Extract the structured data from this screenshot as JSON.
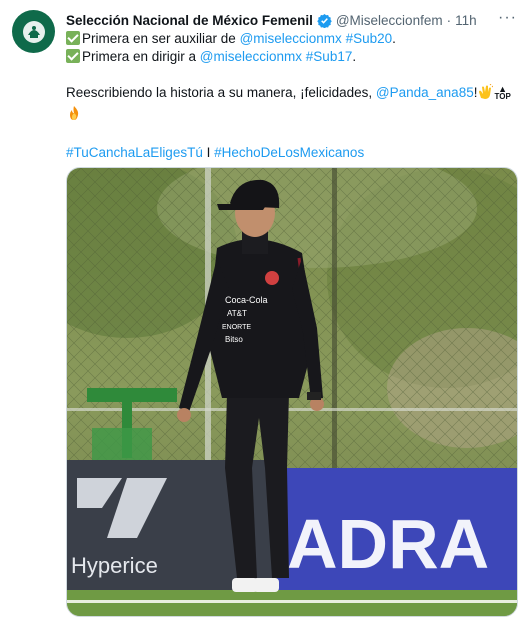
{
  "tweet": {
    "author": {
      "display_name": "Selección Nacional de México Femenil",
      "handle": "@Miseleccionfem",
      "verified": true
    },
    "separator": "·",
    "time": "11h",
    "more_label": "···",
    "text": {
      "line1_prefix": "Primera en ser auxiliar de ",
      "line1_mention": "@miseleccionmx",
      "line1_space": " ",
      "line1_hashtag": "#Sub20",
      "line1_suffix": ".",
      "line2_prefix": "Primera en dirigir a ",
      "line2_mention": "@miseleccionmx",
      "line2_space": " ",
      "line2_hashtag": "#Sub17",
      "line2_suffix": ".",
      "line3_prefix": "Reescribiendo la historia a su manera, ¡felicidades, ",
      "line3_mention": "@Panda_ana85",
      "line3_suffix": "!",
      "top_badge": "TOP",
      "hashtag_a": "#TuCanchaLaEligesTú",
      "hashtag_sep": " I ",
      "hashtag_b": "#HechoDeLosMexicanos"
    },
    "media": {
      "jersey_sponsor_lines": [
        "Coca-Cola",
        "AT&T",
        "ENORTE",
        "Bitso"
      ],
      "banner_left_text": "Hyperice",
      "banner_right_text": "ADRA"
    },
    "colors": {
      "link": "#1d9bf0",
      "verified": "#1d9bf0",
      "check_emoji": "#78b159",
      "avatar_bg": "#0f6a4a"
    },
    "icons": [
      "verified-badge-icon",
      "check-mark-emoji",
      "clapping-hands-emoji",
      "top-arrow-emoji",
      "fire-emoji",
      "more-options-icon"
    ]
  }
}
